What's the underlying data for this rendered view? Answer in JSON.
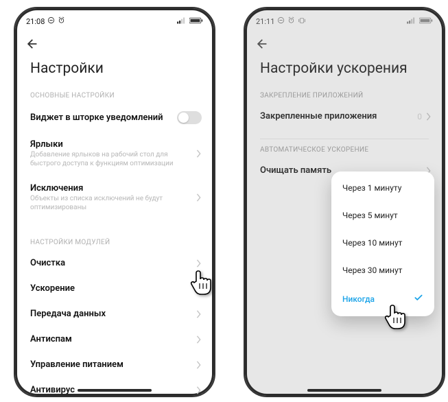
{
  "phone1": {
    "statusbar": {
      "time": "21:08"
    },
    "title": "Настройки",
    "sections": [
      {
        "header": "ОСНОВНЫЕ НАСТРОЙКИ",
        "rows": [
          {
            "title": "Виджет в шторке уведомлений",
            "kind": "toggle"
          },
          {
            "title": "Ярлыки",
            "sub": "Добавление ярлыков на рабочий стол для быстрого доступа к функциям оптимизации",
            "kind": "chev"
          },
          {
            "title": "Исключения",
            "sub": "Объекты из списка исключений не будут оптимизированы",
            "kind": "chev"
          }
        ]
      },
      {
        "header": "НАСТРОЙКИ МОДУЛЕЙ",
        "rows": [
          {
            "title": "Очистка",
            "kind": "chev"
          },
          {
            "title": "Ускорение",
            "kind": "chev"
          },
          {
            "title": "Передача данных",
            "kind": "chev"
          },
          {
            "title": "Антиспам",
            "kind": "chev"
          },
          {
            "title": "Управление питанием",
            "kind": "chev"
          },
          {
            "title": "Антивирус",
            "kind": "chev"
          }
        ]
      }
    ]
  },
  "phone2": {
    "statusbar": {
      "time": "21:11"
    },
    "title": "Настройки ускорения",
    "sections": [
      {
        "header": "ЗАКРЕПЛЕНИЕ ПРИЛОЖЕНИЙ",
        "rows": [
          {
            "title": "Закрепленные приложения",
            "value": "0",
            "kind": "chev"
          }
        ]
      },
      {
        "header": "АВТОМАТИЧЕСКОЕ УСКОРЕНИЕ",
        "rows": [
          {
            "title": "Очищать память",
            "kind": "chev"
          }
        ]
      }
    ],
    "popup": {
      "items": [
        {
          "label": "Через 1 минуту",
          "selected": false
        },
        {
          "label": "Через 5 минут",
          "selected": false
        },
        {
          "label": "Через 10 минут",
          "selected": false
        },
        {
          "label": "Через 30 минут",
          "selected": false
        },
        {
          "label": "Никогда",
          "selected": true
        }
      ]
    }
  }
}
